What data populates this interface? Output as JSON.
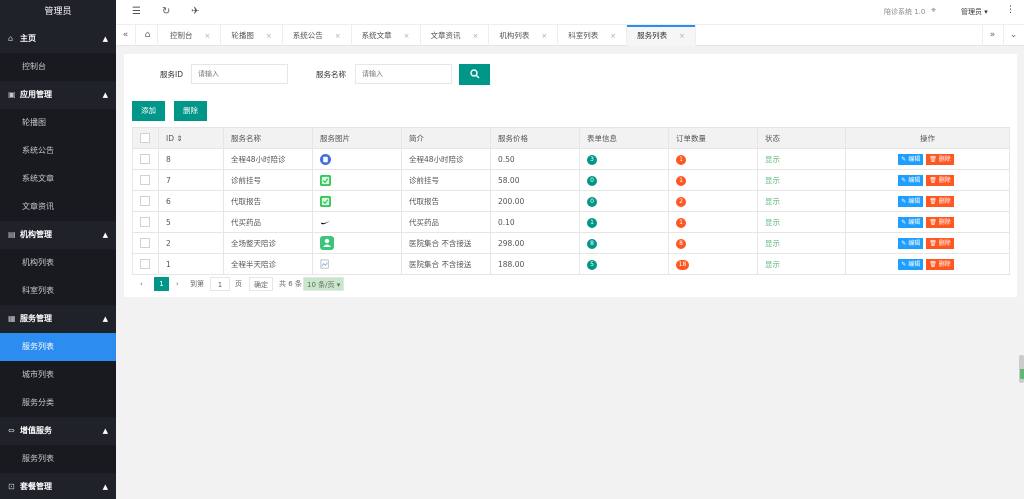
{
  "sidebar": {
    "title": "管理员",
    "groups": [
      {
        "label": "主页",
        "icon": "home-icon",
        "glyph": "⌂",
        "items": [
          "控制台"
        ]
      },
      {
        "label": "应用管理",
        "icon": "app-icon",
        "glyph": "▣",
        "items": [
          "轮播图",
          "系统公告",
          "系统文章",
          "文章资讯"
        ]
      },
      {
        "label": "机构管理",
        "icon": "org-icon",
        "glyph": "▤",
        "items": [
          "机构列表",
          "科室列表"
        ]
      },
      {
        "label": "服务管理",
        "icon": "service-icon",
        "glyph": "▦",
        "items": [
          "服务列表",
          "城市列表",
          "服务分类"
        ]
      },
      {
        "label": "增值服务",
        "icon": "link-icon",
        "glyph": "⇔",
        "items": [
          "服务列表"
        ]
      },
      {
        "label": "套餐管理",
        "icon": "cart-icon",
        "glyph": "⊡",
        "items": []
      }
    ],
    "active_item": "服务列表"
  },
  "topbar": {
    "system_name": "陪诊系统 1.0",
    "user": "管理员 ▾"
  },
  "tabs": {
    "items": [
      "控制台",
      "轮播图",
      "系统公告",
      "系统文章",
      "文章资讯",
      "机构列表",
      "科室列表",
      "服务列表"
    ],
    "active": 7
  },
  "search": {
    "id_label": "服务ID",
    "id_placeholder": "请输入",
    "name_label": "服务名称",
    "name_placeholder": "请输入"
  },
  "actions": {
    "add_label": "添加",
    "delete_label": "删除"
  },
  "table": {
    "columns": [
      "ID ⇕",
      "服务名称",
      "服务图片",
      "简介",
      "服务价格",
      "表单信息",
      "订单数量",
      "状态",
      "操作"
    ],
    "rows": [
      {
        "id": "8",
        "name": "全程48小时陪诊",
        "img": "blue-clipboard-icon",
        "intro": "全程48小时陪诊",
        "price": "0.50",
        "form": "3",
        "orders": "1",
        "status": "显示"
      },
      {
        "id": "7",
        "name": "诊前挂号",
        "img": "green-check-icon",
        "intro": "诊前挂号",
        "price": "58.00",
        "form": "0",
        "orders": "1",
        "status": "显示"
      },
      {
        "id": "6",
        "name": "代取报告",
        "img": "green-check-icon",
        "intro": "代取报告",
        "price": "200.00",
        "form": "0",
        "orders": "2",
        "status": "显示"
      },
      {
        "id": "5",
        "name": "代买药品",
        "img": "swoosh-icon",
        "intro": "代买药品",
        "price": "0.10",
        "form": "1",
        "orders": "1",
        "status": "显示"
      },
      {
        "id": "2",
        "name": "全场整天陪诊",
        "img": "green-person-icon",
        "intro": "医院集合 不含接送",
        "price": "298.00",
        "form": "8",
        "orders": "8",
        "status": "显示"
      },
      {
        "id": "1",
        "name": "全程半天陪诊",
        "img": "broken-image-icon",
        "intro": "医院集合 不含接送",
        "price": "188.00",
        "form": "5",
        "orders": "18",
        "status": "显示"
      }
    ],
    "edit_label": "✎ 编辑",
    "delete_label": "🗑 删除"
  },
  "pager": {
    "prev": "‹",
    "current": "1",
    "next": "›",
    "goto_label": "到第",
    "goto_value": "1",
    "page_unit": "页",
    "confirm": "确定",
    "total": "共 6 条",
    "page_size": "10 条/页 ▾"
  },
  "colors": {
    "primary": "#009688",
    "accent": "#2d8cf0",
    "danger": "#ff5722",
    "sidebar": "#20222a"
  }
}
